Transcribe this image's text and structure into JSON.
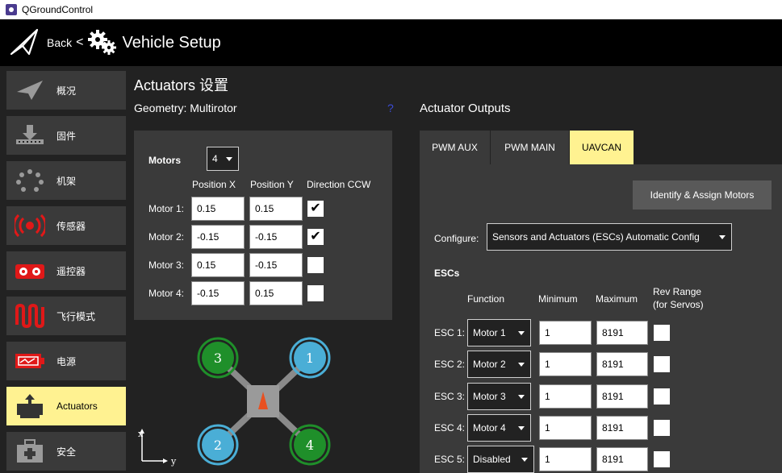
{
  "window": {
    "title": "QGroundControl"
  },
  "toolbar": {
    "back_label": "Back",
    "separator": "<",
    "title": "Vehicle Setup"
  },
  "sidebar": {
    "items": [
      {
        "label": "概况",
        "icon": "plane-icon"
      },
      {
        "label": "固件",
        "icon": "download-icon"
      },
      {
        "label": "机架",
        "icon": "airframe-icon"
      },
      {
        "label": "传感器",
        "icon": "sensor-icon"
      },
      {
        "label": "遥控器",
        "icon": "radio-icon"
      },
      {
        "label": "飞行模式",
        "icon": "flight-modes-icon"
      },
      {
        "label": "电源",
        "icon": "battery-icon"
      },
      {
        "label": "Actuators",
        "icon": "actuator-icon",
        "active": true
      },
      {
        "label": "安全",
        "icon": "safety-icon"
      }
    ]
  },
  "page": {
    "title": "Actuators 设置",
    "geometry": "Geometry: Multirotor",
    "mark": "?",
    "outputs_title": "Actuator Outputs"
  },
  "motors": {
    "label": "Motors",
    "count": "4",
    "headers": {
      "pos_x": "Position X",
      "pos_y": "Position Y",
      "dir": "Direction CCW"
    },
    "rows": [
      {
        "label": "Motor 1:",
        "x": "0.15",
        "y": "0.15",
        "ccw": "✔"
      },
      {
        "label": "Motor 2:",
        "x": "-0.15",
        "y": "-0.15",
        "ccw": "✔"
      },
      {
        "label": "Motor 3:",
        "x": "0.15",
        "y": "-0.15",
        "ccw": ""
      },
      {
        "label": "Motor 4:",
        "x": "-0.15",
        "y": "0.15",
        "ccw": ""
      }
    ]
  },
  "diagram": {
    "motors": [
      {
        "num": "3",
        "color": "#1f8f2a"
      },
      {
        "num": "1",
        "color": "#4aaed6"
      },
      {
        "num": "2",
        "color": "#4aaed6"
      },
      {
        "num": "4",
        "color": "#1f8f2a"
      }
    ],
    "axis_x": "x",
    "axis_y": "y"
  },
  "tabs": [
    {
      "label": "PWM AUX"
    },
    {
      "label": "PWM MAIN"
    },
    {
      "label": "UAVCAN",
      "active": true
    }
  ],
  "outputs": {
    "identify_button": "Identify & Assign Motors",
    "configure_label": "Configure:",
    "configure_value": "Sensors and Actuators (ESCs) Automatic Config",
    "escs_title": "ESCs",
    "headers": {
      "function": "Function",
      "minimum": "Minimum",
      "maximum": "Maximum",
      "rev_range": "Rev Range",
      "rev_range_sub": "(for Servos)"
    },
    "rows": [
      {
        "label": "ESC 1:",
        "function": "Motor 1",
        "min": "1",
        "max": "8191"
      },
      {
        "label": "ESC 2:",
        "function": "Motor 2",
        "min": "1",
        "max": "8191"
      },
      {
        "label": "ESC 3:",
        "function": "Motor 3",
        "min": "1",
        "max": "8191"
      },
      {
        "label": "ESC 4:",
        "function": "Motor 4",
        "min": "1",
        "max": "8191"
      },
      {
        "label": "ESC 5:",
        "function": "Disabled",
        "min": "1",
        "max": "8191"
      }
    ]
  },
  "colors": {
    "accent": "#fff291",
    "panel": "#3a3a3a",
    "background": "#222222"
  }
}
